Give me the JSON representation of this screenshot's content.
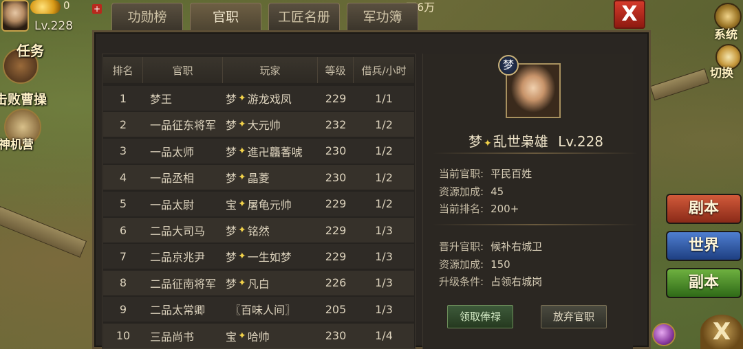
{
  "top_bar": {
    "gold_value": "0",
    "level": "Lv.228",
    "plus": "+",
    "resource_partial_1": "万",
    "resource_partial_2": "6万"
  },
  "left_menu": {
    "task_label": "任务",
    "defeat_label": "击败曹操",
    "shenji_label": "神机营"
  },
  "tabs": [
    {
      "label": "功勋榜",
      "active": false
    },
    {
      "label": "官职",
      "active": true
    },
    {
      "label": "工匠名册",
      "active": false
    },
    {
      "label": "军功簿",
      "active": false
    }
  ],
  "close_label": "X",
  "table": {
    "headers": [
      "排名",
      "官职",
      "玩家",
      "等级",
      "借兵/小时"
    ],
    "rows": [
      {
        "rank": "1",
        "title": "梦王",
        "prefix": "梦",
        "player": "游龙戏凤",
        "level": "229",
        "borrow": "1/1"
      },
      {
        "rank": "2",
        "title": "一品征东将军",
        "prefix": "梦",
        "player": "大元帅",
        "level": "232",
        "borrow": "1/2"
      },
      {
        "rank": "3",
        "title": "一品太师",
        "prefix": "梦",
        "player": "進卍龘萫唬",
        "level": "230",
        "borrow": "1/2"
      },
      {
        "rank": "4",
        "title": "一品丞相",
        "prefix": "梦",
        "player": "晶菱",
        "level": "230",
        "borrow": "1/2"
      },
      {
        "rank": "5",
        "title": "一品太尉",
        "prefix": "宝",
        "player": "屠龟元帅",
        "level": "229",
        "borrow": "1/2"
      },
      {
        "rank": "6",
        "title": "二品大司马",
        "prefix": "梦",
        "player": "铭然",
        "level": "229",
        "borrow": "1/3"
      },
      {
        "rank": "7",
        "title": "二品京兆尹",
        "prefix": "梦",
        "player": "一生如梦",
        "level": "229",
        "borrow": "1/3"
      },
      {
        "rank": "8",
        "title": "二品征南将军",
        "prefix": "梦",
        "player": "凡白",
        "level": "226",
        "borrow": "1/3"
      },
      {
        "rank": "9",
        "title": "二品太常卿",
        "prefix": "",
        "player": "〖百味人间〗",
        "level": "205",
        "borrow": "1/3"
      },
      {
        "rank": "10",
        "title": "三品尚书",
        "prefix": "宝",
        "player": "哈帅",
        "level": "230",
        "borrow": "1/4"
      }
    ]
  },
  "profile": {
    "badge": "梦",
    "name_prefix": "梦",
    "name": "乱世枭雄",
    "level": "Lv.228",
    "current_title_label": "当前官职:",
    "current_title_value": "平民百姓",
    "resource_bonus_label": "资源加成:",
    "resource_bonus_value": "45",
    "current_rank_label": "当前排名:",
    "current_rank_value": "200+",
    "promote_title_label": "晋升官职:",
    "promote_title_value": "候补右城卫",
    "promote_bonus_label": "资源加成:",
    "promote_bonus_value": "150",
    "upgrade_cond_label": "升级条件:",
    "upgrade_cond_value": "占领右城岗",
    "collect_button": "领取俸禄",
    "abandon_button": "放弃官职"
  },
  "right_menu": {
    "system_label": "系统",
    "switch_label": "切换",
    "script_button": "剧本",
    "world_button": "世界",
    "dungeon_button": "副本",
    "close_glyph": "X"
  },
  "colors": {
    "script_button": "#b8442a",
    "world_button": "#2f5ca8",
    "dungeon_button": "#4f8a2a",
    "close_button": "#c8321f"
  }
}
